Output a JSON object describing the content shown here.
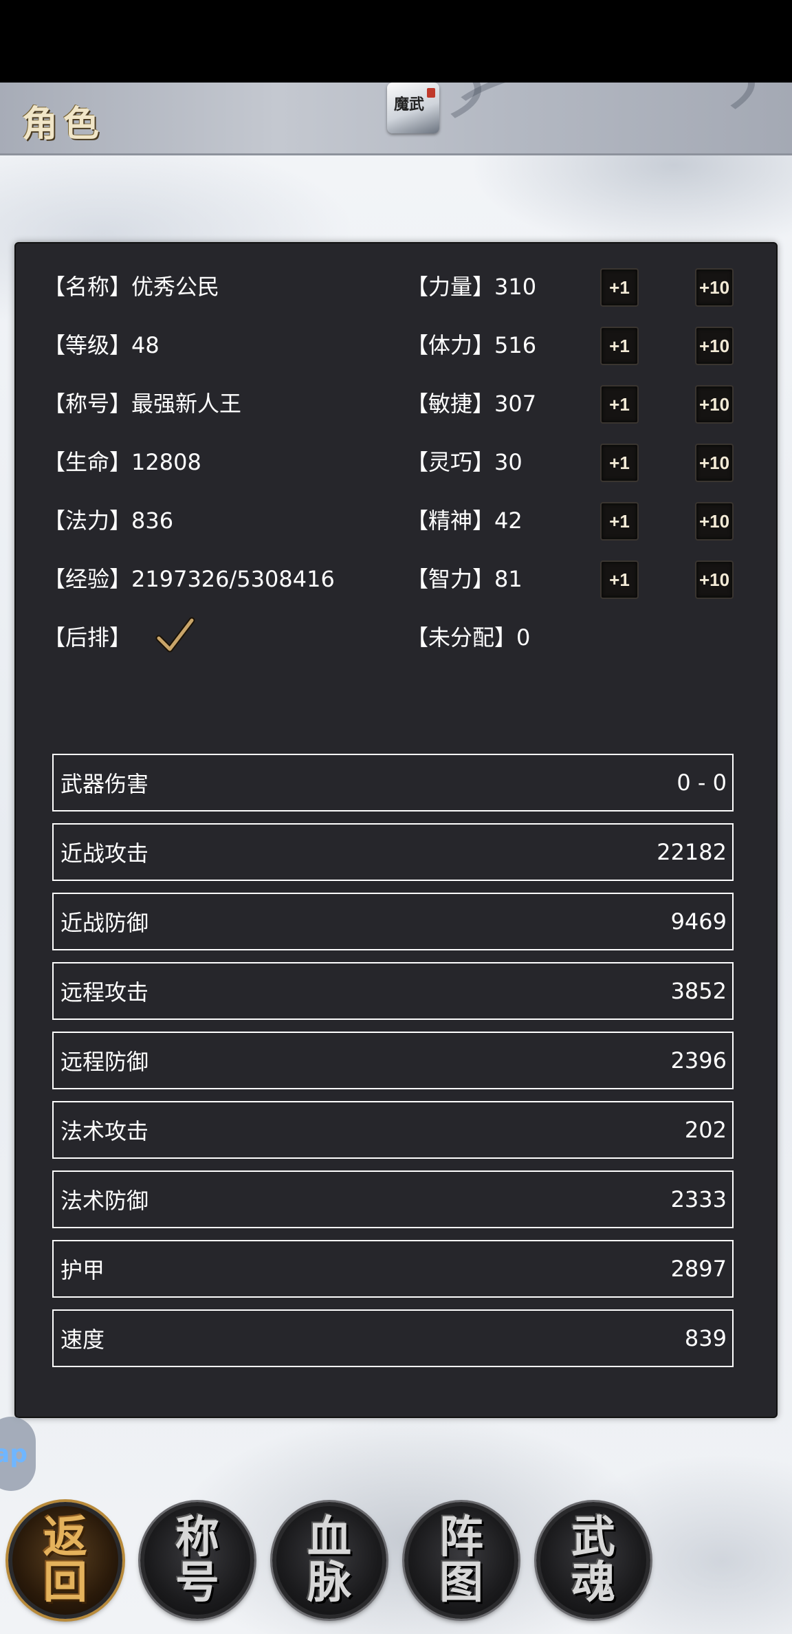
{
  "header": {
    "title": "角色",
    "logo_text": "魔武"
  },
  "character": {
    "left": [
      {
        "label": "【名称】优秀公民"
      },
      {
        "label": "【等级】48"
      },
      {
        "label": "【称号】最强新人王"
      },
      {
        "label": "【生命】12808"
      },
      {
        "label": "【法力】836"
      },
      {
        "label": "【经验】2197326/5308416"
      },
      {
        "label": "【后排】",
        "checked": true
      }
    ],
    "right": [
      {
        "label": "【力量】310"
      },
      {
        "label": "【体力】516"
      },
      {
        "label": "【敏捷】307"
      },
      {
        "label": "【灵巧】30"
      },
      {
        "label": "【精神】42"
      },
      {
        "label": "【智力】81"
      },
      {
        "label": "【未分配】0"
      }
    ],
    "btn_plus1": "+1",
    "btn_plus10": "+10"
  },
  "stats": [
    {
      "name": "武器伤害",
      "value": "0 - 0"
    },
    {
      "name": "近战攻击",
      "value": "22182"
    },
    {
      "name": "近战防御",
      "value": "9469"
    },
    {
      "name": "远程攻击",
      "value": "3852"
    },
    {
      "name": "远程防御",
      "value": "2396"
    },
    {
      "name": "法术攻击",
      "value": "202"
    },
    {
      "name": "法术防御",
      "value": "2333"
    },
    {
      "name": "护甲",
      "value": "2897"
    },
    {
      "name": "速度",
      "value": "839"
    }
  ],
  "side_tab": {
    "label": "ap"
  },
  "bottom_nav": [
    {
      "label": "返回",
      "chars": [
        "返",
        "回"
      ],
      "active": true
    },
    {
      "label": "称号",
      "chars": [
        "称",
        "号"
      ],
      "active": false
    },
    {
      "label": "血脉",
      "chars": [
        "血",
        "脉"
      ],
      "active": false
    },
    {
      "label": "阵图",
      "chars": [
        "阵",
        "图"
      ],
      "active": false
    },
    {
      "label": "武魂",
      "chars": [
        "武",
        "魂"
      ],
      "active": false
    }
  ],
  "colors": {
    "panel": "#26262b",
    "accent_gold": "#e4b25c",
    "text": "#ffffff"
  }
}
